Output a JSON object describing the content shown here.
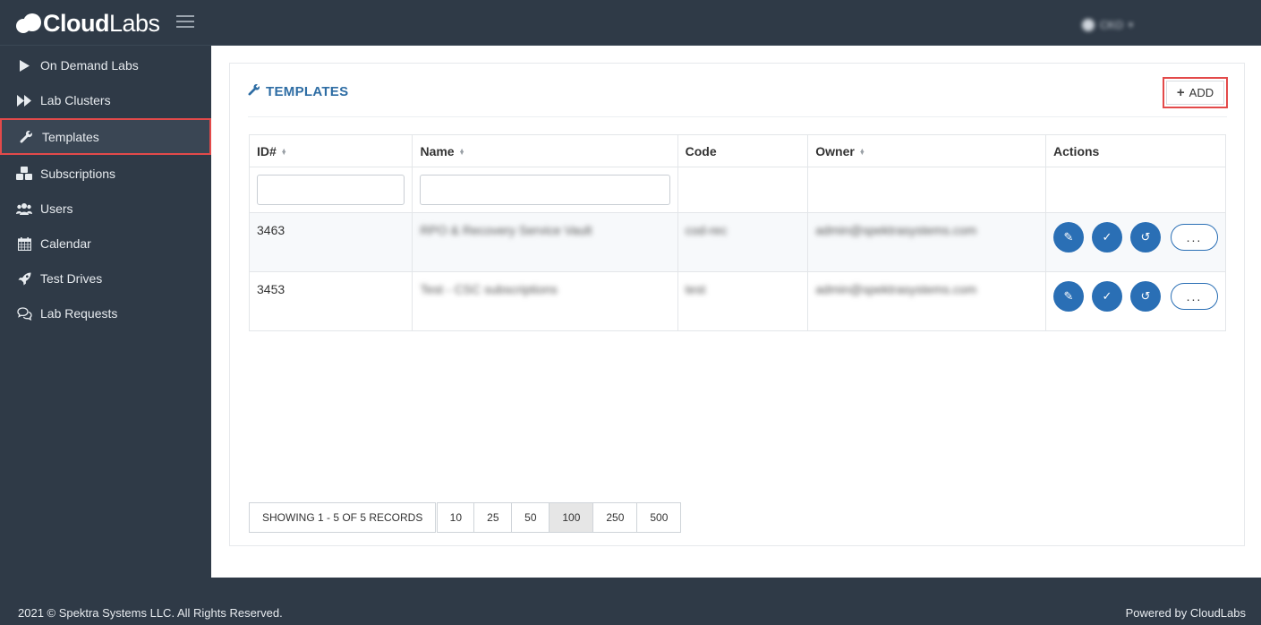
{
  "app": {
    "logo_bold": "Cloud",
    "logo_thin": "Labs"
  },
  "user": {
    "name": "CKO"
  },
  "sidebar": {
    "items": [
      {
        "label": "On Demand Labs",
        "icon": "play-icon"
      },
      {
        "label": "Lab Clusters",
        "icon": "fast-forward-icon"
      },
      {
        "label": "Templates",
        "icon": "wrench-icon",
        "active": true
      },
      {
        "label": "Subscriptions",
        "icon": "cubes-icon"
      },
      {
        "label": "Users",
        "icon": "users-icon"
      },
      {
        "label": "Calendar",
        "icon": "calendar-icon"
      },
      {
        "label": "Test Drives",
        "icon": "rocket-icon"
      },
      {
        "label": "Lab Requests",
        "icon": "comments-icon"
      }
    ]
  },
  "panel": {
    "title": "TEMPLATES",
    "add_label": "ADD"
  },
  "table": {
    "columns": [
      "ID#",
      "Name",
      "Code",
      "Owner",
      "Actions"
    ],
    "rows": [
      {
        "id": "3463",
        "name": "RPO & Recovery Service Vault",
        "code": "cod-rec",
        "owner": "admin@spektrasystems.com"
      },
      {
        "id": "3453",
        "name": "Test - CSC subscriptions",
        "code": "test",
        "owner": "admin@spektrasystems.com"
      }
    ],
    "more_label": "..."
  },
  "pagination": {
    "info": "SHOWING 1 - 5 OF 5 RECORDS",
    "sizes": [
      "10",
      "25",
      "50",
      "100",
      "250",
      "500"
    ],
    "active_size": "100"
  },
  "footer": {
    "copyright": "2021 © Spektra Systems LLC. All Rights Reserved.",
    "powered": "Powered by CloudLabs"
  },
  "colors": {
    "sidebar_bg": "#2f3a47",
    "accent": "#2e6da4",
    "action_button": "#2a6fb5",
    "highlight_border": "#e34a4a"
  }
}
